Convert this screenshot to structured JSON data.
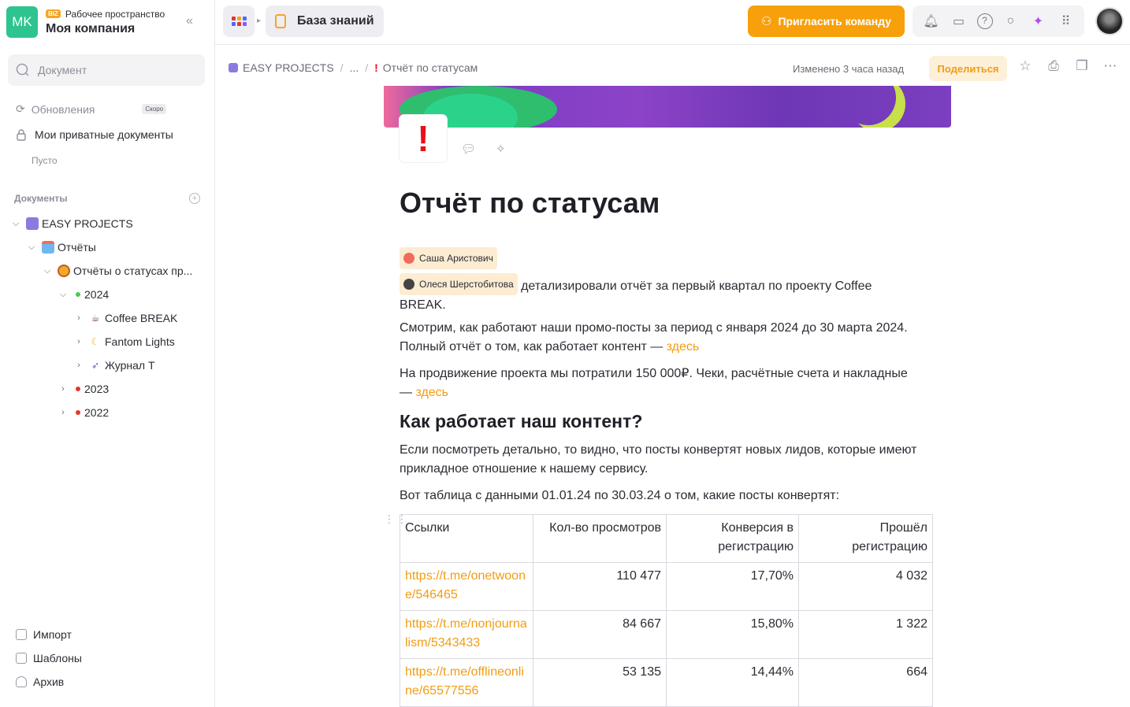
{
  "workspace": {
    "avatar": "MK",
    "badge": "BIZ",
    "label": "Рабочее пространство",
    "name": "Моя компания"
  },
  "search": {
    "placeholder": "Документ"
  },
  "nav": {
    "updates": "Обновления",
    "soon": "Скоро",
    "private_docs": "Мои приватные документы",
    "empty": "Пусто",
    "documents_title": "Документы"
  },
  "tree": {
    "easy_projects": "EASY PROJECTS",
    "reports": "Отчёты",
    "status_reports": "Отчёты о статусах пр...",
    "y2024": "2024",
    "coffee_break": "Coffee BREAK",
    "fantom_lights": "Fantom Lights",
    "journal_t": "Журнал Т",
    "y2023": "2023",
    "y2022": "2022"
  },
  "bottom_nav": {
    "import": "Импорт",
    "templates": "Шаблоны",
    "archive": "Архив"
  },
  "topbar": {
    "knowledge_base": "База знаний",
    "invite": "Пригласить команду"
  },
  "breadcrumb": {
    "root": "EASY PROJECTS",
    "ellipsis": "...",
    "current": "Отчёт по статусам"
  },
  "doc_meta": {
    "changed": "Изменено 3 часа назад",
    "share": "Поделиться"
  },
  "doc": {
    "title": "Отчёт по статусам",
    "mention1": "Саша Аристович",
    "mention2": "Олеся Шерстобитова",
    "p1_text": " детализировали отчёт за первый квартал по проекту Coffee BREAK.",
    "p2_text": "Смотрим, как работают наши промо-посты за период с января 2024 до 30 марта 2024. Полный отчёт о том, как работает контент — ",
    "p2_link": "здесь",
    "p3_text": "На продвижение проекта мы потратили 150 000₽. Чеки, расчётные счета и накладные — ",
    "p3_link": "здесь",
    "h2": "Как работает наш контент?",
    "p4": "Если посмотреть детально, то видно, что посты конвертят новых лидов, которые имеют прикладное отношение к нашему сервису.",
    "p5": "Вот таблица с данными 01.01.24 по 30.03.24 о том, какие посты конвертят:"
  },
  "table": {
    "headers": [
      "Ссылки",
      "Кол-во просмотров",
      "Конверсия в регистрацию",
      "Прошёл регистрацию"
    ],
    "rows": [
      [
        "https://t.me/onetwoone/546465",
        "110 477",
        "17,70%",
        "4 032"
      ],
      [
        "https://t.me/nonjournalism/5343433",
        "84 667",
        "15,80%",
        "1 322"
      ],
      [
        "https://t.me/offlineonline/65577556",
        "53 135",
        "14,44%",
        "664"
      ]
    ]
  },
  "colors": {
    "accent": "#f7a00a",
    "workspace_avatar": "#2ec48f",
    "link": "#f39c12"
  },
  "icons": [
    "collapse-icon",
    "search-icon",
    "refresh-icon",
    "lock-icon",
    "plus-icon",
    "bell-icon",
    "folder-icon",
    "help-icon",
    "search-icon",
    "sparkle-icon",
    "grid-icon",
    "star-icon",
    "print-icon",
    "copy-icon",
    "more-icon",
    "comment-icon",
    "exclamation-emoji"
  ]
}
